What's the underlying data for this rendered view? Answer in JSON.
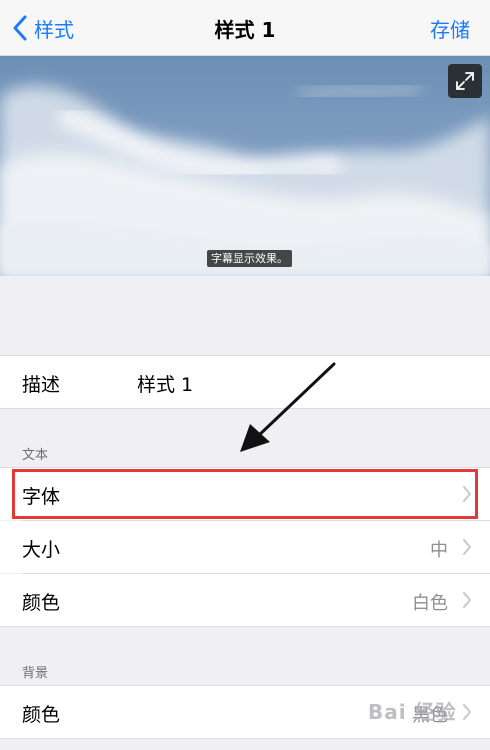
{
  "nav": {
    "back_label": "样式",
    "title": "样式 1",
    "save_label": "存储"
  },
  "preview": {
    "subtitle_text": "字幕显示效果。"
  },
  "description_row": {
    "label": "描述",
    "value": "样式 1"
  },
  "text_section": {
    "header": "文本",
    "rows": [
      {
        "label": "字体",
        "value": ""
      },
      {
        "label": "大小",
        "value": "中"
      },
      {
        "label": "颜色",
        "value": "白色"
      }
    ]
  },
  "background_section": {
    "header": "背景",
    "rows": [
      {
        "label": "颜色",
        "value": "黑色"
      }
    ]
  },
  "watermark": "Bai 经验",
  "colors": {
    "accent": "#1a7bff",
    "highlight_box": "#e53935"
  }
}
